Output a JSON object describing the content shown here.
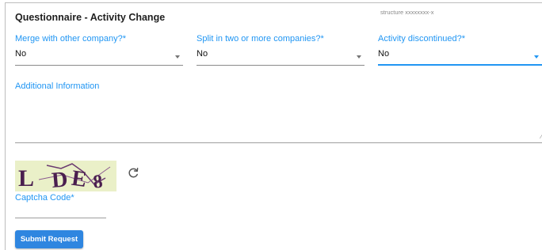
{
  "form": {
    "title": "Questionnaire - Activity Change",
    "structure_note": "structure xxxxxxxx-x"
  },
  "fields": [
    {
      "label": "Merge with other company?*",
      "value": "No",
      "icon": "chevron-down-icon"
    },
    {
      "label": "Split in two or more companies?*",
      "value": "No",
      "icon": "chevron-down-icon"
    },
    {
      "label": "Activity discontinued?*",
      "value": "No",
      "icon": "chevron-down-icon",
      "focused": true
    }
  ],
  "additional_info": {
    "label": "Additional Information",
    "value": "",
    "icon": "resize-handle-icon"
  },
  "captcha": {
    "image_text": "LDE8",
    "refresh_icon": "refresh-icon",
    "label": "Captcha Code*",
    "value": ""
  },
  "submit": {
    "label": "Submit Request"
  },
  "colors": {
    "accent": "#2196f3",
    "button": "#2f86e0",
    "captcha_bg": "#eaf0c8",
    "captcha_ink": "#4a1f4f"
  }
}
